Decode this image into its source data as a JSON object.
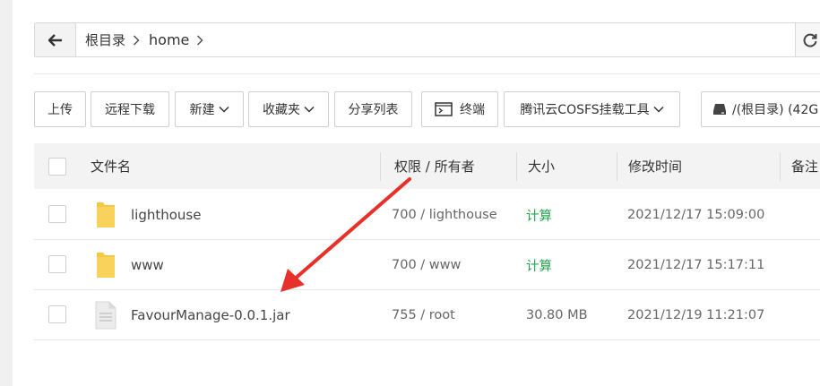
{
  "path": {
    "crumbs": [
      "根目录",
      "home"
    ]
  },
  "toolbar": {
    "upload": "上传",
    "remote_download": "远程下载",
    "new": "新建",
    "favorites": "收藏夹",
    "share_list": "分享列表",
    "terminal": "终端",
    "cosfs": "腾讯云COSFS挂载工具",
    "disk": "/(根目录) (42G"
  },
  "table": {
    "headers": {
      "name": "文件名",
      "perm": "权限 / 所有者",
      "size": "大小",
      "mtime": "修改时间",
      "note": "备注"
    },
    "rows": [
      {
        "type": "folder",
        "name": "lighthouse",
        "perm": "700 / lighthouse",
        "size": "计算",
        "mtime": "2021/12/17 15:09:00"
      },
      {
        "type": "folder",
        "name": "www",
        "perm": "700 / www",
        "size": "计算",
        "mtime": "2021/12/17 15:17:11"
      },
      {
        "type": "file",
        "name": "FavourManage-0.0.1.jar",
        "perm": "755 / root",
        "size": "30.80 MB",
        "mtime": "2021/12/19 11:21:07"
      }
    ]
  },
  "colors": {
    "folder": "#f5c842",
    "calc_link": "#2aa152",
    "annotation_arrow": "#e8302a"
  }
}
